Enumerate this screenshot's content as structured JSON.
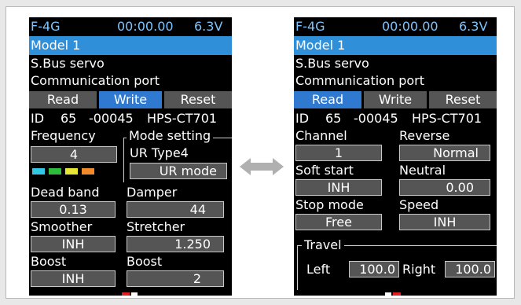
{
  "screen1": {
    "header": {
      "model_code": "F-4G",
      "timer": "00:00.00",
      "voltage": "6.3V"
    },
    "model_name": "Model 1",
    "title_line1": "S.Bus servo",
    "title_line2": "Communication port",
    "buttons": {
      "read": "Read",
      "write": "Write",
      "reset": "Reset",
      "active": "write"
    },
    "id_line": {
      "id_label": "ID",
      "id_value": "65",
      "serial": "-00045",
      "servo_model": "HPS-CT701"
    },
    "frequency": {
      "label": "Frequency",
      "value": "4"
    },
    "mode_setting": {
      "title": "Mode setting",
      "type": "UR Type4",
      "value": "UR mode"
    },
    "swatches": [
      "#33c7e6",
      "#2ebd3b",
      "#e6e633",
      "#f08a2a"
    ],
    "dead_band": {
      "label": "Dead band",
      "value": "0.13"
    },
    "damper": {
      "label": "Damper",
      "value": "44"
    },
    "smoother": {
      "label": "Smoother",
      "value": "INH"
    },
    "stretcher": {
      "label": "Stretcher",
      "value": "1.250"
    },
    "boost_left": {
      "label": "Boost",
      "value": "INH"
    },
    "boost_right": {
      "label": "Boost",
      "value": "2"
    }
  },
  "screen2": {
    "header": {
      "model_code": "F-4G",
      "timer": "00:00.00",
      "voltage": "6.3V"
    },
    "model_name": "Model 1",
    "title_line1": "S.Bus servo",
    "title_line2": "Communication port",
    "buttons": {
      "read": "Read",
      "write": "Write",
      "reset": "Reset",
      "active": "read"
    },
    "id_line": {
      "id_label": "ID",
      "id_value": "65",
      "serial": "-00045",
      "servo_model": "HPS-CT701"
    },
    "channel": {
      "label": "Channel",
      "value": "1"
    },
    "reverse": {
      "label": "Reverse",
      "value": "Normal"
    },
    "soft_start": {
      "label": "Soft start",
      "value": "INH"
    },
    "neutral": {
      "label": "Neutral",
      "value": "0.00"
    },
    "stop_mode": {
      "label": "Stop mode",
      "value": "Free"
    },
    "speed": {
      "label": "Speed",
      "value": "INH"
    },
    "travel": {
      "title": "Travel",
      "left_label": "Left",
      "left_value": "100.0",
      "right_label": "Right",
      "right_value": "100.0"
    }
  },
  "colors": {
    "accent": "#2f8fd8",
    "active_button": "#2f79d0",
    "field_bg": "#555555",
    "arrow": "#b0b0b0"
  },
  "connector_icon": "double-arrow-icon"
}
